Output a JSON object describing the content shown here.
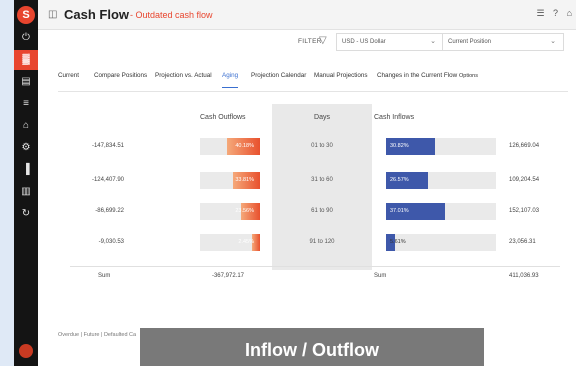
{
  "sidebar": {
    "logo_glyph": "S",
    "items": [
      {
        "name": "power-icon",
        "glyph": "⏻",
        "active": false
      },
      {
        "name": "chart-icon",
        "glyph": "▓",
        "active": true
      },
      {
        "name": "document-icon",
        "glyph": "▤",
        "active": false
      },
      {
        "name": "list-icon",
        "glyph": "≡",
        "active": false
      },
      {
        "name": "bank-icon",
        "glyph": "⌂",
        "active": false
      },
      {
        "name": "gear-icon",
        "glyph": "⚙",
        "active": false
      },
      {
        "name": "bars-icon",
        "glyph": "▐",
        "active": false
      },
      {
        "name": "file-icon",
        "glyph": "▥",
        "active": false
      },
      {
        "name": "refresh-icon",
        "glyph": "↻",
        "active": false
      }
    ]
  },
  "header": {
    "title": "Cash Flow",
    "subtitle": "- Outdated cash flow",
    "icons": [
      "☰",
      "?",
      "⌂"
    ]
  },
  "filter": {
    "label": "FILTER",
    "currency": "USD - US Dollar",
    "position": "Current Position"
  },
  "tabs": [
    {
      "label": "Current",
      "active": false
    },
    {
      "label": "Compare Positions",
      "active": false
    },
    {
      "label": "Projection vs. Actual",
      "active": false
    },
    {
      "label": "Aging",
      "active": true
    },
    {
      "label": "Projection Calendar",
      "active": false
    },
    {
      "label": "Manual Projections",
      "active": false
    },
    {
      "label": "Changes in the Current Flow",
      "active": false
    },
    {
      "label": "Options",
      "active": false
    }
  ],
  "table": {
    "headers": {
      "outflows": "Cash Outflows",
      "days": "Days",
      "inflows": "Cash Inflows"
    },
    "rows": [
      {
        "outflow": "-147,834.51",
        "outflow_pct": "40.18%",
        "outflow_frac": 0.4018,
        "days": "01 to 30",
        "inflow_pct": "30.82%",
        "inflow_frac": 0.3082,
        "inflow": "126,669.04"
      },
      {
        "outflow": "-124,407.90",
        "outflow_pct": "33.81%",
        "outflow_frac": 0.3381,
        "days": "31 to 60",
        "inflow_pct": "26.57%",
        "inflow_frac": 0.2657,
        "inflow": "109,204.54"
      },
      {
        "outflow": "-86,699.22",
        "outflow_pct": "23.56%",
        "outflow_frac": 0.2356,
        "days": "61 to 90",
        "inflow_pct": "37.01%",
        "inflow_frac": 0.3701,
        "inflow": "152,107.03"
      },
      {
        "outflow": "-9,030.53",
        "outflow_pct": "2.45%",
        "outflow_frac": 0.0245,
        "days": "91 to 120",
        "inflow_pct": "5.61%",
        "inflow_frac": 0.0561,
        "inflow": "23,056.31"
      }
    ],
    "sum_label": "Sum",
    "sum_outflow": "-367,972.17",
    "sum_label_right": "Sum",
    "sum_inflow": "411,036.93"
  },
  "legend": "Overdue | Future | Defaulted Ca",
  "caption": "Inflow / Outflow",
  "colors": {
    "accent": "#e8452e",
    "inflow_bar": "#3e58aa",
    "tab_active": "#3a6fd0"
  }
}
